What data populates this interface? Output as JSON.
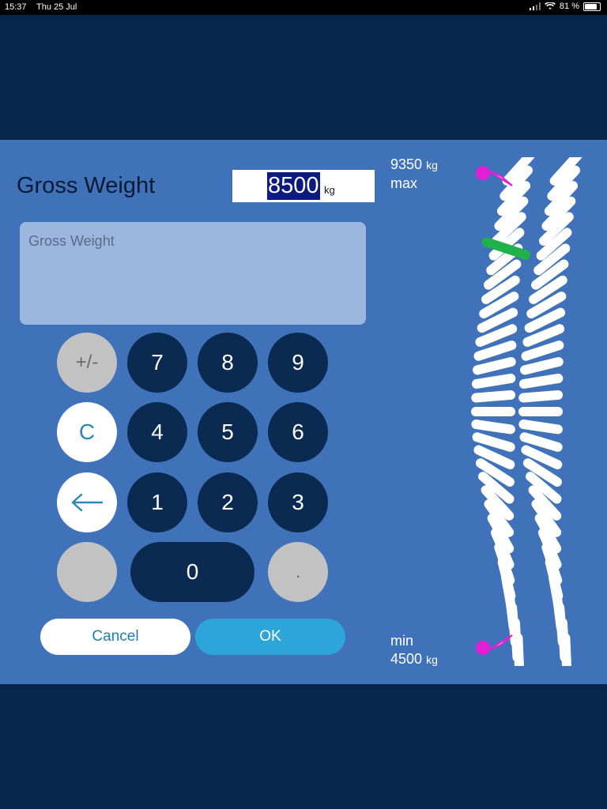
{
  "status": {
    "time": "15:37",
    "date": "Thu 25 Jul",
    "battery": "81 %",
    "battery_level": 0.81
  },
  "dialog": {
    "title": "Gross Weight",
    "value": "8500",
    "unit": "kg",
    "description": "Gross Weight"
  },
  "keypad": {
    "plus_minus": "+/-",
    "clear": "C",
    "backspace_icon": "left-arrow-icon",
    "k7": "7",
    "k8": "8",
    "k9": "9",
    "k4": "4",
    "k5": "5",
    "k6": "6",
    "k1": "1",
    "k2": "2",
    "k3": "3",
    "k0": "0",
    "decimal": "."
  },
  "buttons": {
    "cancel": "Cancel",
    "ok": "OK"
  },
  "gauge": {
    "max_value": "9350",
    "max_unit": "kg",
    "max_label": "max",
    "min_label": "min",
    "min_value": "4500",
    "min_unit": "kg",
    "current_value": 8500,
    "max": 9350,
    "min": 4500,
    "colors": {
      "marker": "#21b14b",
      "limit_indicator": "#e21fd6",
      "stripe": "#ffffff"
    }
  }
}
